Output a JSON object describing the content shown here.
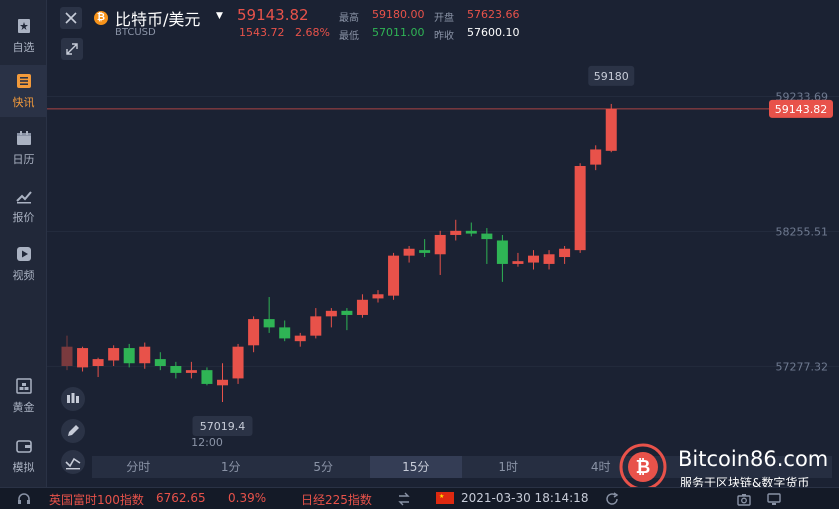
{
  "sidebar": {
    "items": [
      {
        "label": "自选",
        "icon": "bookmark-icon"
      },
      {
        "label": "快讯",
        "icon": "news-list-icon",
        "active": true
      },
      {
        "label": "日历",
        "icon": "calendar-icon"
      },
      {
        "label": "报价",
        "icon": "trend-line-icon"
      },
      {
        "label": "视频",
        "icon": "play-icon"
      },
      {
        "label": "黄金",
        "icon": "gold-bars-icon"
      },
      {
        "label": "模拟",
        "icon": "wallet-icon"
      }
    ]
  },
  "header": {
    "pair_name": "比特币/美元",
    "pair_symbol": "BTCUSD",
    "price": "59143.82",
    "change_abs": "1543.72",
    "change_pct": "2.68%",
    "high_label": "最高",
    "high_value": "59180.00",
    "low_label": "最低",
    "low_value": "57011.00",
    "open_label": "开盘",
    "open_value": "57623.66",
    "prev_label": "昨收",
    "prev_value": "57600.10"
  },
  "chart": {
    "current_price_tag": "59143.82",
    "high_marker": "59180",
    "low_marker": "57019.4",
    "time_label": "12:00",
    "timeframes": [
      "分时",
      "1分",
      "5分",
      "15分",
      "1时",
      "4时"
    ],
    "active_timeframe": "15分"
  },
  "chart_data": {
    "type": "candlestick",
    "y_ticks": [
      "59233.69",
      "58255.51",
      "57277.32"
    ],
    "ylim": [
      56700,
      59600
    ],
    "current_price": 59143.82,
    "colors": {
      "up": "#e8524a",
      "down": "#2fb455"
    },
    "candles": [
      {
        "o": 57420,
        "h": 57500,
        "l": 57250,
        "c": 57280
      },
      {
        "o": 57270,
        "h": 57420,
        "l": 57240,
        "c": 57410
      },
      {
        "o": 57280,
        "h": 57340,
        "l": 57200,
        "c": 57330
      },
      {
        "o": 57320,
        "h": 57430,
        "l": 57280,
        "c": 57410
      },
      {
        "o": 57410,
        "h": 57440,
        "l": 57270,
        "c": 57300
      },
      {
        "o": 57300,
        "h": 57450,
        "l": 57260,
        "c": 57420
      },
      {
        "o": 57330,
        "h": 57380,
        "l": 57250,
        "c": 57280
      },
      {
        "o": 57280,
        "h": 57310,
        "l": 57190,
        "c": 57230
      },
      {
        "o": 57230,
        "h": 57310,
        "l": 57190,
        "c": 57250
      },
      {
        "o": 57250,
        "h": 57270,
        "l": 57140,
        "c": 57150
      },
      {
        "o": 57140,
        "h": 57300,
        "l": 57019,
        "c": 57180
      },
      {
        "o": 57190,
        "h": 57440,
        "l": 57150,
        "c": 57420
      },
      {
        "o": 57430,
        "h": 57640,
        "l": 57380,
        "c": 57620
      },
      {
        "o": 57620,
        "h": 57780,
        "l": 57520,
        "c": 57560
      },
      {
        "o": 57560,
        "h": 57610,
        "l": 57460,
        "c": 57480
      },
      {
        "o": 57460,
        "h": 57520,
        "l": 57420,
        "c": 57500
      },
      {
        "o": 57500,
        "h": 57700,
        "l": 57480,
        "c": 57640
      },
      {
        "o": 57640,
        "h": 57700,
        "l": 57560,
        "c": 57680
      },
      {
        "o": 57680,
        "h": 57700,
        "l": 57540,
        "c": 57650
      },
      {
        "o": 57650,
        "h": 57800,
        "l": 57630,
        "c": 57760
      },
      {
        "o": 57770,
        "h": 57830,
        "l": 57740,
        "c": 57800
      },
      {
        "o": 57790,
        "h": 58100,
        "l": 57760,
        "c": 58080
      },
      {
        "o": 58080,
        "h": 58150,
        "l": 58030,
        "c": 58130
      },
      {
        "o": 58120,
        "h": 58200,
        "l": 58070,
        "c": 58100
      },
      {
        "o": 58090,
        "h": 58260,
        "l": 57940,
        "c": 58230
      },
      {
        "o": 58230,
        "h": 58340,
        "l": 58190,
        "c": 58260
      },
      {
        "o": 58260,
        "h": 58320,
        "l": 58220,
        "c": 58240
      },
      {
        "o": 58240,
        "h": 58280,
        "l": 58020,
        "c": 58200
      },
      {
        "o": 58190,
        "h": 58230,
        "l": 57890,
        "c": 58020
      },
      {
        "o": 58020,
        "h": 58100,
        "l": 58000,
        "c": 58040
      },
      {
        "o": 58030,
        "h": 58120,
        "l": 57980,
        "c": 58080
      },
      {
        "o": 58020,
        "h": 58120,
        "l": 57980,
        "c": 58090
      },
      {
        "o": 58070,
        "h": 58150,
        "l": 58020,
        "c": 58130
      },
      {
        "o": 58120,
        "h": 58750,
        "l": 58100,
        "c": 58730
      },
      {
        "o": 58740,
        "h": 58880,
        "l": 58700,
        "c": 58850
      },
      {
        "o": 58840,
        "h": 59180,
        "l": 58830,
        "c": 59143.82
      }
    ]
  },
  "footer": {
    "ftse_label": "英国富时100指数",
    "ftse_value": "6762.65",
    "ftse_pct": "0.39%",
    "nikkei_label": "日经225指数",
    "datetime": "2021-03-30 18:14:18"
  },
  "watermark": {
    "title": "Bitcoin86.com",
    "subtitle": "服务于区块链&数字货币"
  }
}
